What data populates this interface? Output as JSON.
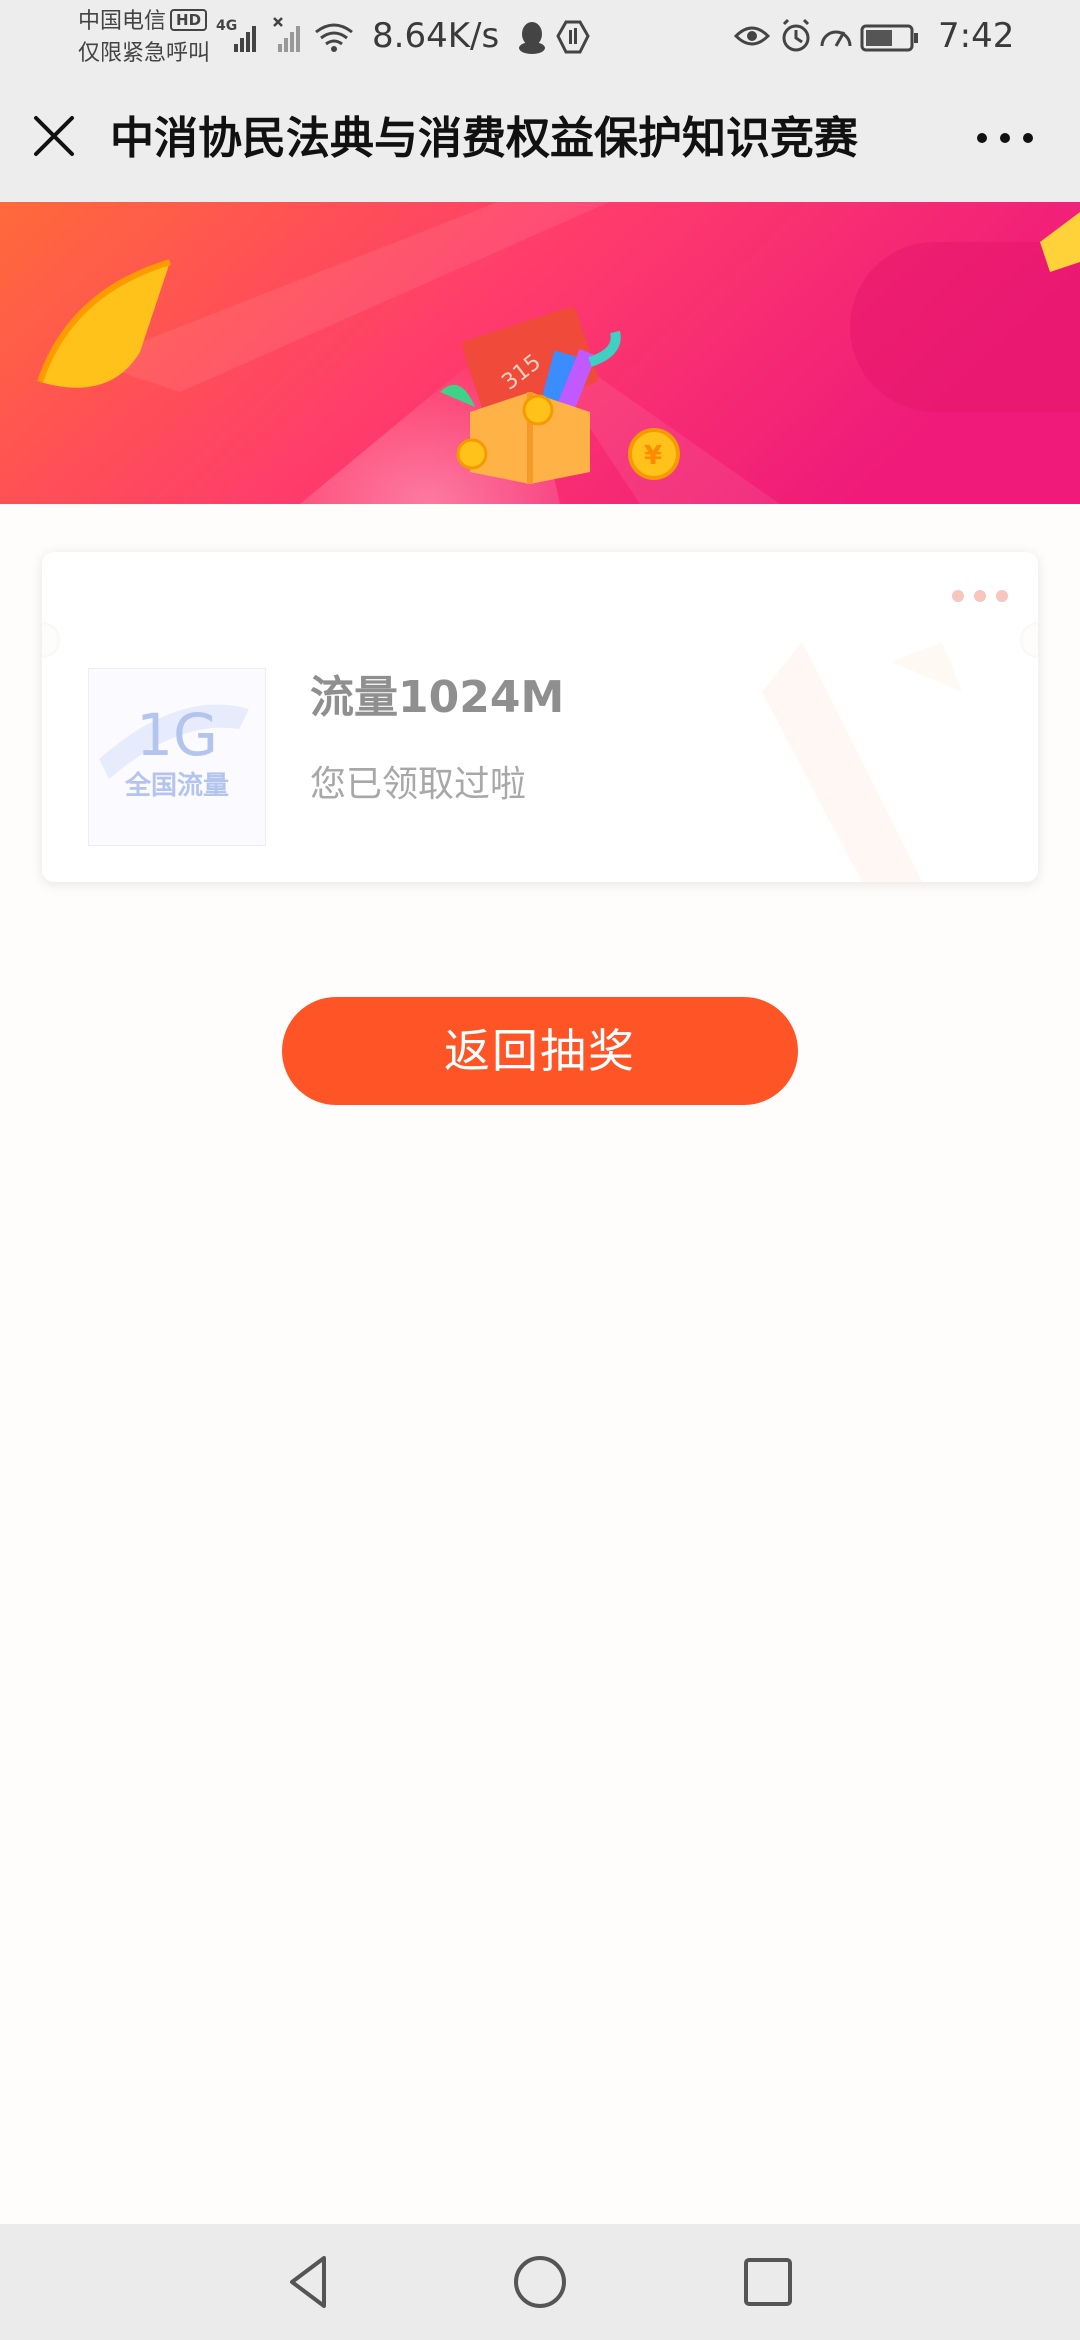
{
  "status_bar": {
    "carrier_line1": "中国电信",
    "hd_badge": "HD",
    "carrier_line2": "仅限紧急呼叫",
    "network_type": "4G",
    "net_speed": "8.64K/s",
    "time": "7:42",
    "icons": [
      "signal-icon",
      "no-signal-icon",
      "wifi-icon",
      "qq-icon",
      "hand-icon",
      "eye-icon",
      "alarm-icon",
      "speed-gauge-icon",
      "battery-icon"
    ]
  },
  "title_bar": {
    "title": "中消协民法典与消费权益保护知识竞赛",
    "close_icon": "close-icon",
    "more_icon": "more-icon"
  },
  "prize": {
    "thumb_big": "1G",
    "thumb_sub": "全国流量",
    "name": "流量1024M",
    "status": "您已领取过啦"
  },
  "actions": {
    "return_label": "返回抽奖"
  },
  "nav_bar": {
    "icons": [
      "back-icon",
      "home-icon",
      "recent-apps-icon"
    ]
  },
  "colors": {
    "banner_left": "#ff6a3a",
    "banner_right": "#ef1a7a",
    "button": "#ff5426",
    "status_bar_bg": "#ededed"
  }
}
